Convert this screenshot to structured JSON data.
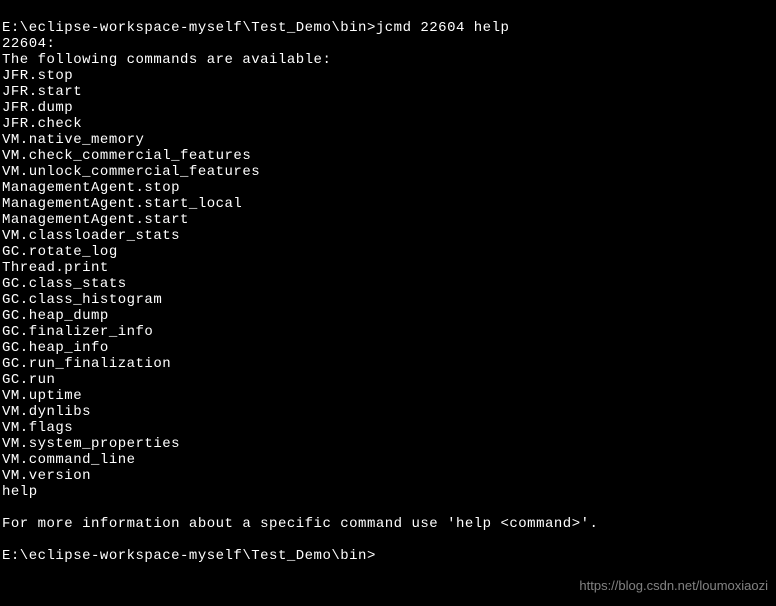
{
  "prompt1": "E:\\eclipse-workspace-myself\\Test_Demo\\bin>",
  "command1": "jcmd 22604 help",
  "pid_line": "22604:",
  "header": "The following commands are available:",
  "commands": [
    "JFR.stop",
    "JFR.start",
    "JFR.dump",
    "JFR.check",
    "VM.native_memory",
    "VM.check_commercial_features",
    "VM.unlock_commercial_features",
    "ManagementAgent.stop",
    "ManagementAgent.start_local",
    "ManagementAgent.start",
    "VM.classloader_stats",
    "GC.rotate_log",
    "Thread.print",
    "GC.class_stats",
    "GC.class_histogram",
    "GC.heap_dump",
    "GC.finalizer_info",
    "GC.heap_info",
    "GC.run_finalization",
    "GC.run",
    "VM.uptime",
    "VM.dynlibs",
    "VM.flags",
    "VM.system_properties",
    "VM.command_line",
    "VM.version",
    "help"
  ],
  "footer": "For more information about a specific command use 'help <command>'.",
  "prompt2": "E:\\eclipse-workspace-myself\\Test_Demo\\bin>",
  "watermark": "https://blog.csdn.net/loumoxiaozi"
}
